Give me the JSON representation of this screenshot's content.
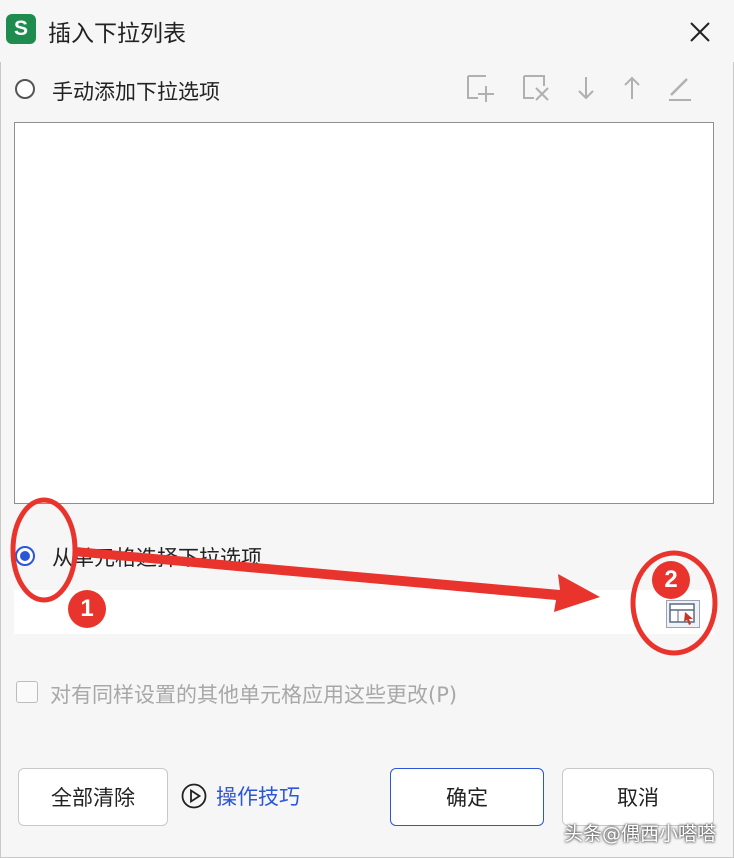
{
  "window": {
    "title": "插入下拉列表",
    "logo_letter": "S",
    "close_icon": "close-icon"
  },
  "options": {
    "manual_label": "手动添加下拉选项",
    "manual_selected": false,
    "from_cells_label": "从单元格选择下拉选项",
    "from_cells_selected": true
  },
  "toolbar": {
    "icons": [
      "add-item-icon",
      "delete-item-icon",
      "move-down-icon",
      "move-up-icon",
      "edit-icon"
    ]
  },
  "range_input": {
    "value": ""
  },
  "apply_same": {
    "label": "对有同样设置的其他单元格应用这些更改(P)",
    "checked": false,
    "enabled": false
  },
  "buttons": {
    "clear_all": "全部清除",
    "tips": "操作技巧",
    "ok": "确定",
    "cancel": "取消"
  },
  "annotations": {
    "badge_1": "1",
    "badge_2": "2",
    "color": "#e8342c"
  },
  "watermark": "头条@偶西小嗒嗒",
  "colors": {
    "accent": "#2a57d8",
    "logo": "#1e8c4e"
  }
}
